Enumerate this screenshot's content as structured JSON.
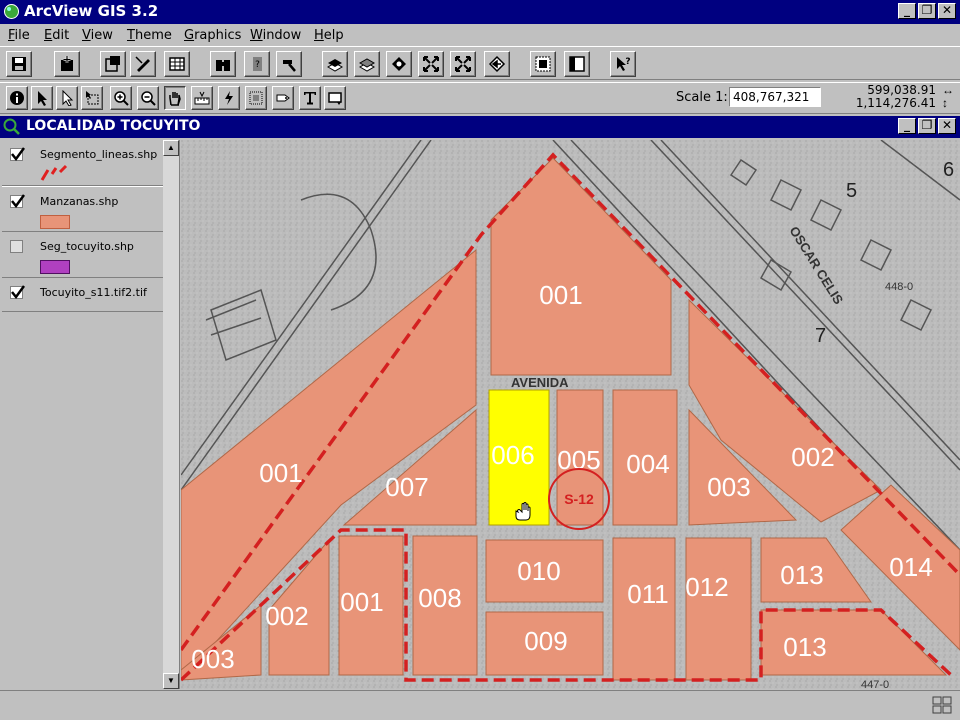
{
  "app": {
    "title": "ArcView GIS 3.2"
  },
  "menu": [
    {
      "id": "file",
      "label": "File"
    },
    {
      "id": "edit",
      "label": "Edit"
    },
    {
      "id": "view",
      "label": "View"
    },
    {
      "id": "theme",
      "label": "Theme"
    },
    {
      "id": "graphics",
      "label": "Graphics"
    },
    {
      "id": "window",
      "label": "Window"
    },
    {
      "id": "help",
      "label": "Help"
    }
  ],
  "toolbar": {
    "scale_label": "Scale 1:",
    "scale_value": "408,767,321",
    "coord_x": "599,038.91",
    "coord_y": "1,114,276.41"
  },
  "view": {
    "title": "LOCALIDAD TOCUYITO"
  },
  "toc": {
    "layers": [
      {
        "name": "Segmento_lineas.shp",
        "visible": true,
        "symbol": "red-dashed-line",
        "color": "#e02020"
      },
      {
        "name": "Manzanas.shp",
        "visible": true,
        "symbol": "fill",
        "color": "#e89478"
      },
      {
        "name": "Seg_tocuyito.shp",
        "visible": false,
        "symbol": "fill",
        "color": "#b040c0"
      },
      {
        "name": "Tocuyito_s11.tif2.tif",
        "visible": true,
        "symbol": "image",
        "color": ""
      }
    ]
  },
  "map": {
    "block_color": "#e89478",
    "selected_color": "#ffff00",
    "boundary_color": "#d42020",
    "sector_label": "S-12",
    "blocks": [
      {
        "id": "b001-top",
        "label": "001"
      },
      {
        "id": "b001-left",
        "label": "001"
      },
      {
        "id": "b002-right",
        "label": "002"
      },
      {
        "id": "b003-right",
        "label": "003"
      },
      {
        "id": "b004",
        "label": "004"
      },
      {
        "id": "b005",
        "label": "005"
      },
      {
        "id": "b006",
        "label": "006"
      },
      {
        "id": "b007",
        "label": "007"
      },
      {
        "id": "b010",
        "label": "010"
      },
      {
        "id": "b009",
        "label": "009"
      },
      {
        "id": "b011",
        "label": "011"
      },
      {
        "id": "b012",
        "label": "012"
      },
      {
        "id": "b013-upper",
        "label": "013"
      },
      {
        "id": "b013-lower",
        "label": "013"
      },
      {
        "id": "b014",
        "label": "014"
      },
      {
        "id": "b008",
        "label": "008"
      },
      {
        "id": "b001-bottom",
        "label": "001"
      },
      {
        "id": "b002-bottom",
        "label": "002"
      },
      {
        "id": "b003-bottom",
        "label": "003"
      }
    ],
    "background_labels": [
      {
        "id": "avenida-top",
        "text": "AVENIDA"
      },
      {
        "id": "oscar-celis",
        "text": "OSCAR CELIS"
      },
      {
        "id": "num-5",
        "text": "5"
      },
      {
        "id": "num-7",
        "text": "7"
      },
      {
        "id": "num-6",
        "text": "6"
      },
      {
        "id": "num-448",
        "text": "448-0"
      },
      {
        "id": "num-447",
        "text": "447-0"
      }
    ]
  }
}
